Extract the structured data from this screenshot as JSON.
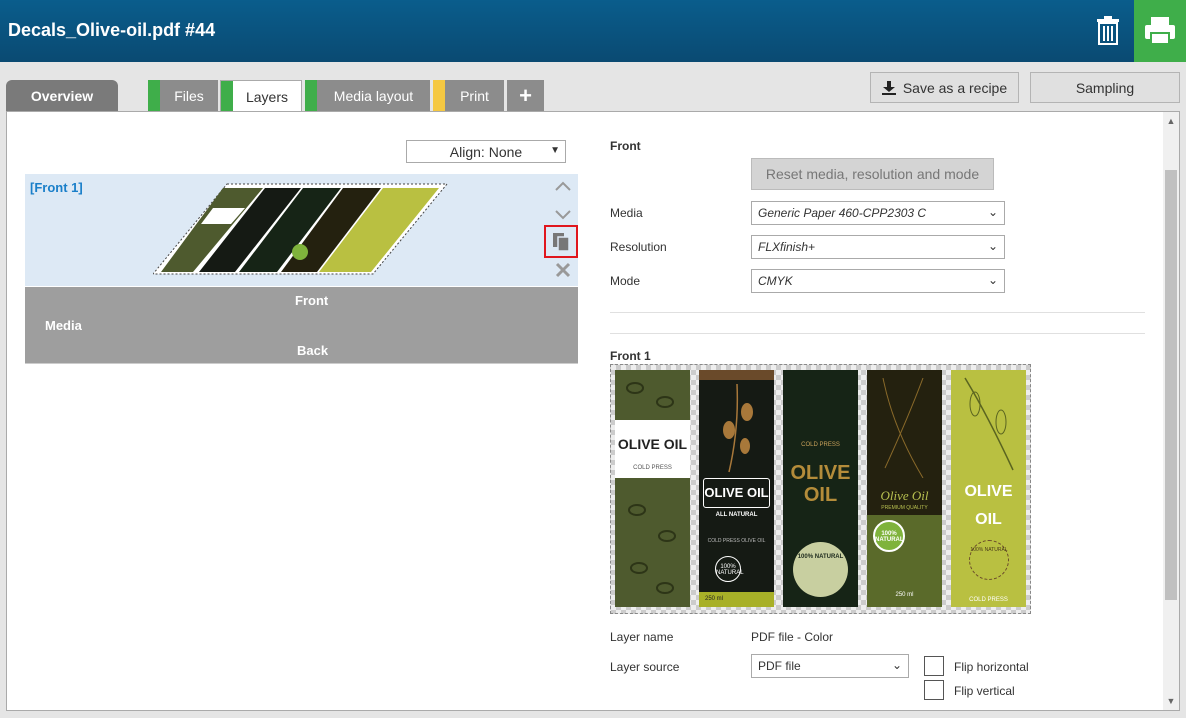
{
  "header": {
    "title": "Decals_Olive-oil.pdf #44",
    "trash_icon": "trash-icon",
    "print_icon": "printer-icon"
  },
  "tabs": [
    {
      "label": "Overview",
      "stripe": ""
    },
    {
      "label": "Files",
      "stripe": "#3fae4a"
    },
    {
      "label": "Layers",
      "stripe": "#3fae4a"
    },
    {
      "label": "Media layout",
      "stripe": "#3fae4a"
    },
    {
      "label": "Print",
      "stripe": "#f5c842"
    },
    {
      "label": "+",
      "stripe": ""
    }
  ],
  "actions": {
    "save_recipe": "Save as a recipe",
    "sampling": "Sampling"
  },
  "left": {
    "align": "Align: None",
    "layer_label": "[Front 1]",
    "media_table": {
      "front": "Front",
      "media": "Media",
      "back": "Back"
    }
  },
  "right": {
    "front_title": "Front",
    "reset_button": "Reset media, resolution and mode",
    "media_label": "Media",
    "media_value": "Generic Paper 460-CPP2303 C",
    "resolution_label": "Resolution",
    "resolution_value": "FLXfinish+",
    "mode_label": "Mode",
    "mode_value": "CMYK",
    "front1_title": "Front 1",
    "layer_name_label": "Layer name",
    "layer_name_value": "PDF file - Color",
    "layer_source_label": "Layer source",
    "layer_source_value": "PDF file",
    "flip_horizontal": "Flip horizontal",
    "flip_vertical": "Flip vertical"
  },
  "labels": [
    {
      "title": "OLIVE OIL",
      "sub": "COLD PRESS",
      "bg": "#4e5a2e"
    },
    {
      "title": "OLIVE OIL",
      "sub": "ALL NATURAL",
      "bg": "#151a14"
    },
    {
      "title": "OLIVE OIL",
      "sub": "COLD PRESS",
      "bg": "#162416"
    },
    {
      "title": "Olive Oil",
      "sub": "PREMIUM QUALITY",
      "bg": "#24210f"
    },
    {
      "title": "OLIVE OIL",
      "sub": "COLD PRESS",
      "bg": "#b9c041"
    }
  ],
  "label_extras": {
    "natural": "100% NATURAL",
    "volume": "250 ml",
    "cold_press_oil": "COLD PRESS OLIVE OIL"
  },
  "colors": {
    "header": "#0a5d8c",
    "print_green": "#3fae4a",
    "accent_blue": "#1a7fc9",
    "highlight_red": "#e0161d"
  }
}
